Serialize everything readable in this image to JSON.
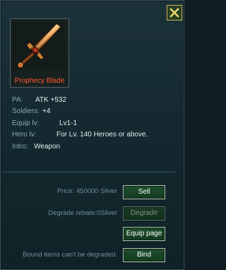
{
  "item": {
    "name": "Prophecy Blade",
    "icon": "sword-icon"
  },
  "stats": [
    {
      "label": "PA:",
      "value": "ATK +532"
    },
    {
      "label": "Soldiers:",
      "value": "+4"
    },
    {
      "label": "Equip lv:",
      "value": "Lv1-1"
    },
    {
      "label": "Hero lv:",
      "value": "For Lv. 140 Heroes or above."
    },
    {
      "label": "Intro:",
      "value": "Weapon"
    }
  ],
  "actions": {
    "price_text": "Price: 450000 Silver",
    "sell_label": "Sell",
    "rebate_text": "Degrade rebate:0Silver",
    "degrade_label": "Degrade",
    "equip_page_label": "Equip page",
    "bound_note": "Bound items can't be degraded.",
    "bind_label": "Bind"
  },
  "colors": {
    "item_name": "#ff5a2e",
    "label": "#86a9b3",
    "value": "#e6eef0",
    "close_x": "#e9d36a"
  }
}
